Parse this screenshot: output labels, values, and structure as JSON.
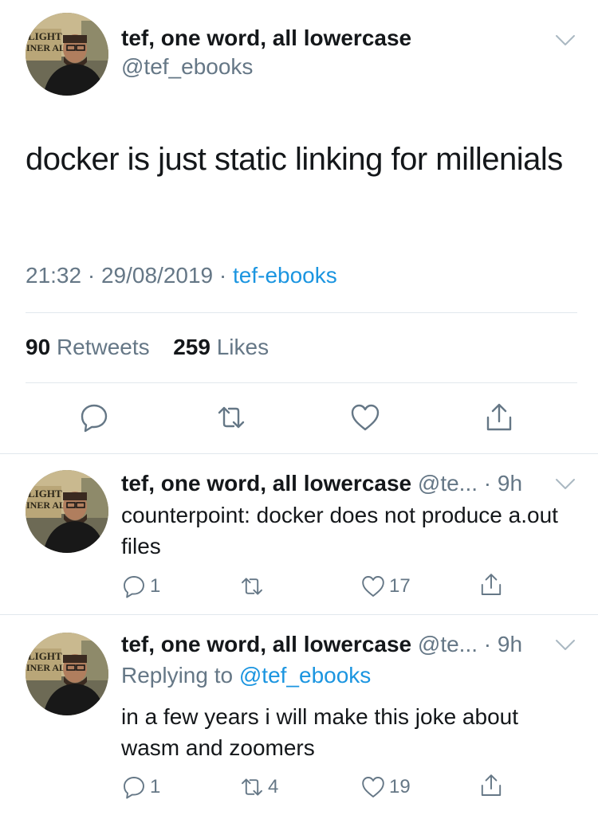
{
  "main_tweet": {
    "author_name": "tef, one word, all lowercase",
    "handle": "@tef_ebooks",
    "text": "docker is just static linking for millenials",
    "time": "21:32",
    "date": "29/08/2019",
    "source": "tef-ebooks",
    "retweet_count": "90",
    "retweet_label": "Retweets",
    "like_count": "259",
    "like_label": "Likes"
  },
  "replies": [
    {
      "author_name": "tef, one word, all lowercase",
      "handle": "@te...",
      "age": "9h",
      "text": "counterpoint: docker does not produce a.out files",
      "reply_count": "1",
      "retweet_count": "",
      "like_count": "17"
    },
    {
      "author_name": "tef, one word, all lowercase",
      "handle": "@te...",
      "age": "9h",
      "replying_to_prefix": "Replying to",
      "replying_to_handle": "@tef_ebooks",
      "text": "in a few years i will make this joke about wasm and zoomers",
      "reply_count": "1",
      "retweet_count": "4",
      "like_count": "19"
    }
  ],
  "icons": {
    "menu": "chevron-down-icon",
    "reply": "reply-icon",
    "retweet": "retweet-icon",
    "like": "heart-icon",
    "share": "share-icon"
  },
  "colors": {
    "text": "#14171a",
    "muted": "#657786",
    "link": "#1b95e0",
    "divider": "#e1e8ed"
  }
}
